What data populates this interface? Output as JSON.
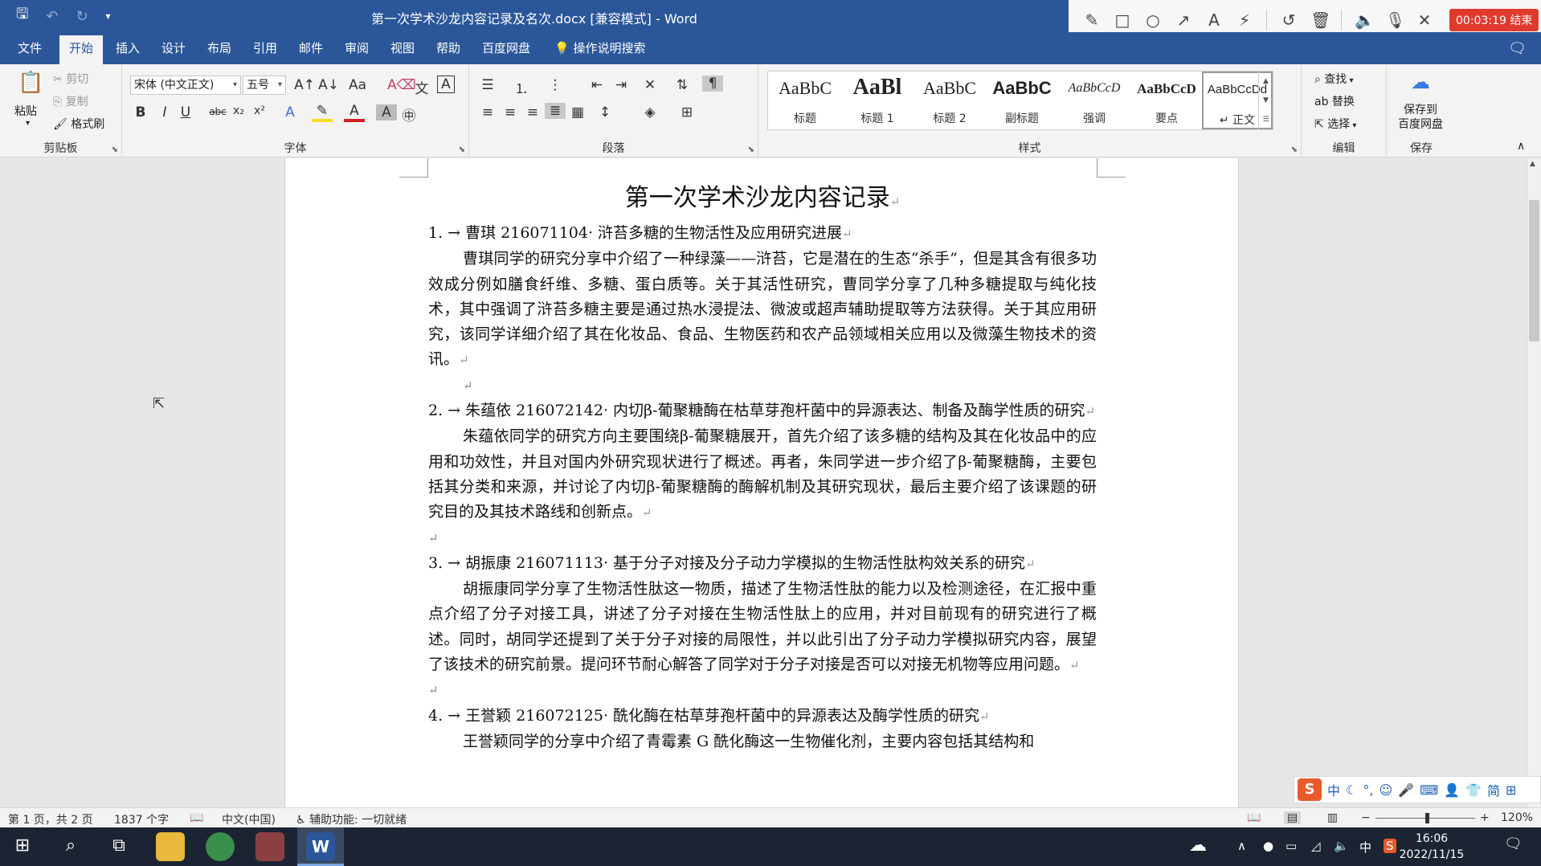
{
  "window": {
    "title": "第一次学术沙龙内容记录及名次.docx [兼容模式]  -  Word"
  },
  "quick_access": {
    "save_icon": "save-icon",
    "undo_icon": "undo-icon",
    "redo_icon": "redo-icon",
    "customize_icon": "chevron-down-icon"
  },
  "recorder": {
    "tools": [
      "pencil-icon",
      "rectangle-icon",
      "circle-icon",
      "arrow-icon",
      "text-icon",
      "magic-wand-icon",
      "rotate-icon",
      "trash-icon",
      "speaker-icon",
      "microphone-icon",
      "close-icon"
    ],
    "timer": "00:03:19 结束"
  },
  "tabs": [
    "文件",
    "开始",
    "插入",
    "设计",
    "布局",
    "引用",
    "邮件",
    "审阅",
    "视图",
    "帮助",
    "百度网盘"
  ],
  "active_tab": "开始",
  "tell_me": "操作说明搜索",
  "ribbon": {
    "clipboard": {
      "paste": "粘贴",
      "cut": "剪切",
      "copy": "复制",
      "format_painter": "格式刷",
      "label": "剪贴板"
    },
    "font": {
      "font_name": "宋体 (中文正文)",
      "font_size": "五号",
      "label": "字体",
      "buttons": [
        "B",
        "I",
        "U",
        "abc",
        "x₂",
        "x²"
      ]
    },
    "paragraph": {
      "label": "段落"
    },
    "styles": {
      "label": "样式",
      "items": [
        {
          "sample": "AaBbC",
          "name": "标题"
        },
        {
          "sample": "AaBl",
          "name": "标题 1"
        },
        {
          "sample": "AaBbC",
          "name": "标题 2"
        },
        {
          "sample": "AaBbC",
          "name": "副标题"
        },
        {
          "sample": "AaBbCcD",
          "name": "强调"
        },
        {
          "sample": "AaBbCcD",
          "name": "要点"
        },
        {
          "sample": "AaBbCcDd",
          "name": "↵ 正文"
        }
      ]
    },
    "editing": {
      "find": "查找",
      "replace": "替换",
      "select": "选择",
      "label": "编辑"
    },
    "save": {
      "button": "保存到\n百度网盘",
      "label": "保存"
    }
  },
  "document": {
    "heading": "第一次学术沙龙内容记录",
    "items": [
      {
        "head": "1. →  曹琪 216071104· 浒苔多糖的生物活性及应用研究进展",
        "body": "曹琪同学的研究分享中介绍了一种绿藻——浒苔，它是潜在的生态“杀手”，但是其含有很多功效成分例如膳食纤维、多糖、蛋白质等。关于其活性研究，曹同学分享了几种多糖提取与纯化技术，其中强调了浒苔多糖主要是通过热水浸提法、微波或超声辅助提取等方法获得。关于其应用研究，该同学详细介绍了其在化妆品、食品、生物医药和农产品领域相关应用以及微藻生物技术的资讯。"
      },
      {
        "head": "2. →  朱蕴依 216072142· 内切β-葡聚糖酶在枯草芽孢杆菌中的异源表达、制备及酶学性质的研究",
        "body": "朱蕴依同学的研究方向主要围绕β-葡聚糖展开，首先介绍了该多糖的结构及其在化妆品中的应用和功效性，并且对国内外研究现状进行了概述。再者，朱同学进一步介绍了β-葡聚糖酶，主要包括其分类和来源，并讨论了内切β-葡聚糖酶的酶解机制及其研究现状，最后主要介绍了该课题的研究目的及其技术路线和创新点。"
      },
      {
        "head": "3. →  胡振康 216071113· 基于分子对接及分子动力学模拟的生物活性肽构效关系的研究",
        "body": "胡振康同学分享了生物活性肽这一物质，描述了生物活性肽的能力以及检测途径，在汇报中重点介绍了分子对接工具，讲述了分子对接在生物活性肽上的应用，并对目前现有的研究进行了概述。同时，胡同学还提到了关于分子对接的局限性，并以此引出了分子动力学模拟研究内容，展望了该技术的研究前景。提问环节耐心解答了同学对于分子对接是否可以对接无机物等应用问题。"
      },
      {
        "head": "4. →  王誉颖 216072125· 酰化酶在枯草芽孢杆菌中的异源表达及酶学性质的研究",
        "body": "王誉颖同学的分享中介绍了青霉素 G 酰化酶这一生物催化剂，主要内容包括其结构和"
      }
    ]
  },
  "ime": {
    "items": [
      "中",
      "☾",
      "°,",
      "☺",
      "🎤",
      "⌨",
      "👤",
      "👕",
      "简",
      "⊞"
    ]
  },
  "status": {
    "page": "第 1 页，共 2 页",
    "words": "1837 个字",
    "language": "中文(中国)",
    "accessibility": "辅助功能: 一切就绪",
    "zoom": "120%"
  },
  "taskbar": {
    "time": "16:06",
    "date": "2022/11/15",
    "ime_indicator": "中"
  }
}
